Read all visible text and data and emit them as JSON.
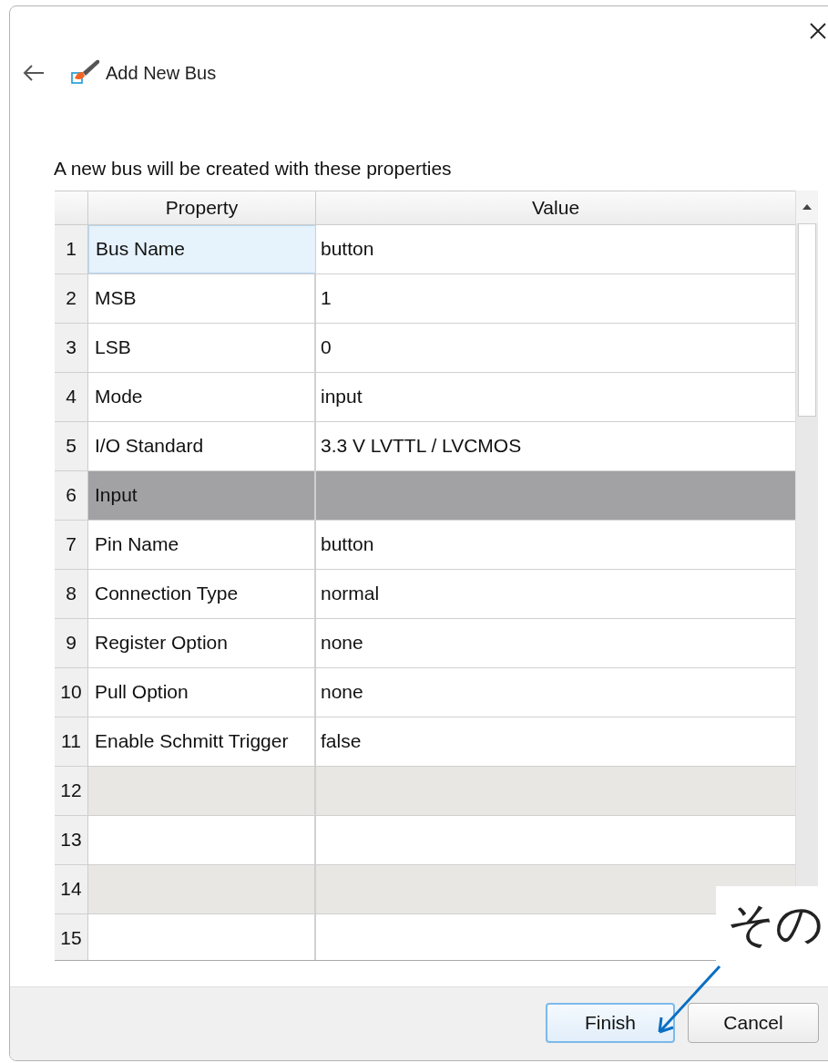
{
  "window": {
    "title": "Add New Bus"
  },
  "description": "A new bus will be created with these properties",
  "table": {
    "columns": [
      "Property",
      "Value"
    ],
    "rows": [
      {
        "number": "1",
        "property": "Bus Name",
        "value": "button",
        "kind": "data",
        "selected": true,
        "shaded": false
      },
      {
        "number": "2",
        "property": "MSB",
        "value": "1",
        "kind": "data",
        "selected": false,
        "shaded": false
      },
      {
        "number": "3",
        "property": "LSB",
        "value": "0",
        "kind": "data",
        "selected": false,
        "shaded": false
      },
      {
        "number": "4",
        "property": "Mode",
        "value": "input",
        "kind": "data",
        "selected": false,
        "shaded": false
      },
      {
        "number": "5",
        "property": "I/O Standard",
        "value": "3.3 V LVTTL / LVCMOS",
        "kind": "data",
        "selected": false,
        "shaded": false
      },
      {
        "number": "6",
        "property": "Input",
        "kind": "section",
        "selected": false,
        "shaded": false
      },
      {
        "number": "7",
        "property": "Pin Name",
        "value": "button",
        "kind": "data",
        "selected": false,
        "shaded": false
      },
      {
        "number": "8",
        "property": "Connection Type",
        "value": "normal",
        "kind": "data",
        "selected": false,
        "shaded": false
      },
      {
        "number": "9",
        "property": "Register Option",
        "value": "none",
        "kind": "data",
        "selected": false,
        "shaded": false
      },
      {
        "number": "10",
        "property": "Pull Option",
        "value": "none",
        "kind": "data",
        "selected": false,
        "shaded": false
      },
      {
        "number": "11",
        "property": "Enable Schmitt Trigger",
        "value": "false",
        "kind": "data",
        "selected": false,
        "shaded": false
      },
      {
        "number": "12",
        "kind": "data",
        "selected": false,
        "shaded": true
      },
      {
        "number": "13",
        "kind": "data",
        "selected": false,
        "shaded": false
      },
      {
        "number": "14",
        "kind": "data",
        "selected": false,
        "shaded": true
      },
      {
        "number": "15",
        "kind": "data",
        "selected": false,
        "shaded": false
      }
    ]
  },
  "buttons": [
    {
      "label": "Finish",
      "default": true
    },
    {
      "label": "Cancel",
      "default": false
    }
  ],
  "annotation": {
    "text": "その"
  }
}
